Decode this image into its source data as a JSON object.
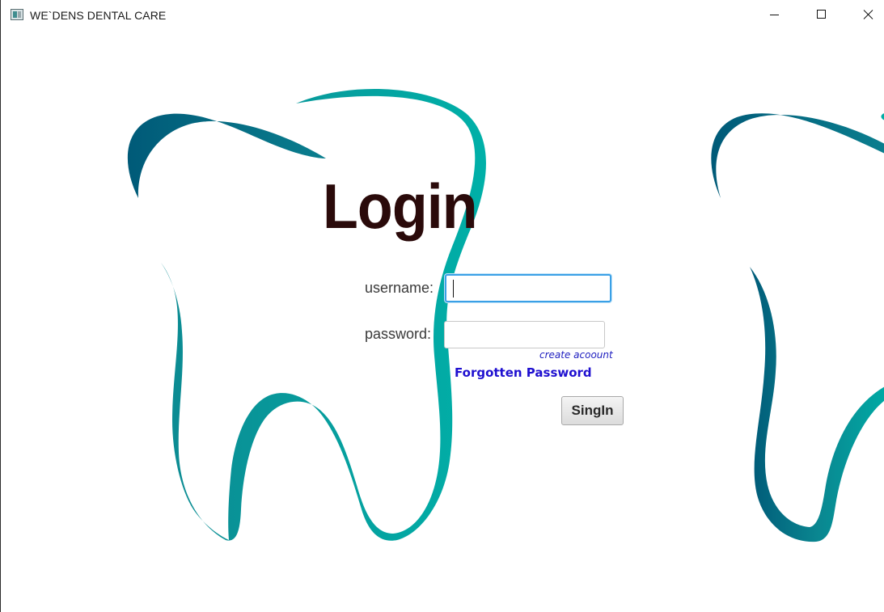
{
  "window": {
    "title": "WE`DENS DENTAL CARE",
    "icons": {
      "app": "app-window-icon",
      "minimize": "minimize-icon",
      "maximize": "maximize-icon",
      "close": "close-icon"
    }
  },
  "background": {
    "logo": "tooth-logo",
    "colors": {
      "teal_light": "#00ada6",
      "teal_dark": "#005a78"
    }
  },
  "login": {
    "heading": "Login",
    "username_label": "username:",
    "username_value": "",
    "password_label": "password:",
    "password_value": "",
    "create_account_link": "create acoount",
    "forgot_password_link": "Forgotten Password",
    "signin_button": "SingIn"
  },
  "colors": {
    "heading": "#2a0a0a",
    "link": "#1f10d0",
    "focus_border": "#3aa0e6"
  }
}
